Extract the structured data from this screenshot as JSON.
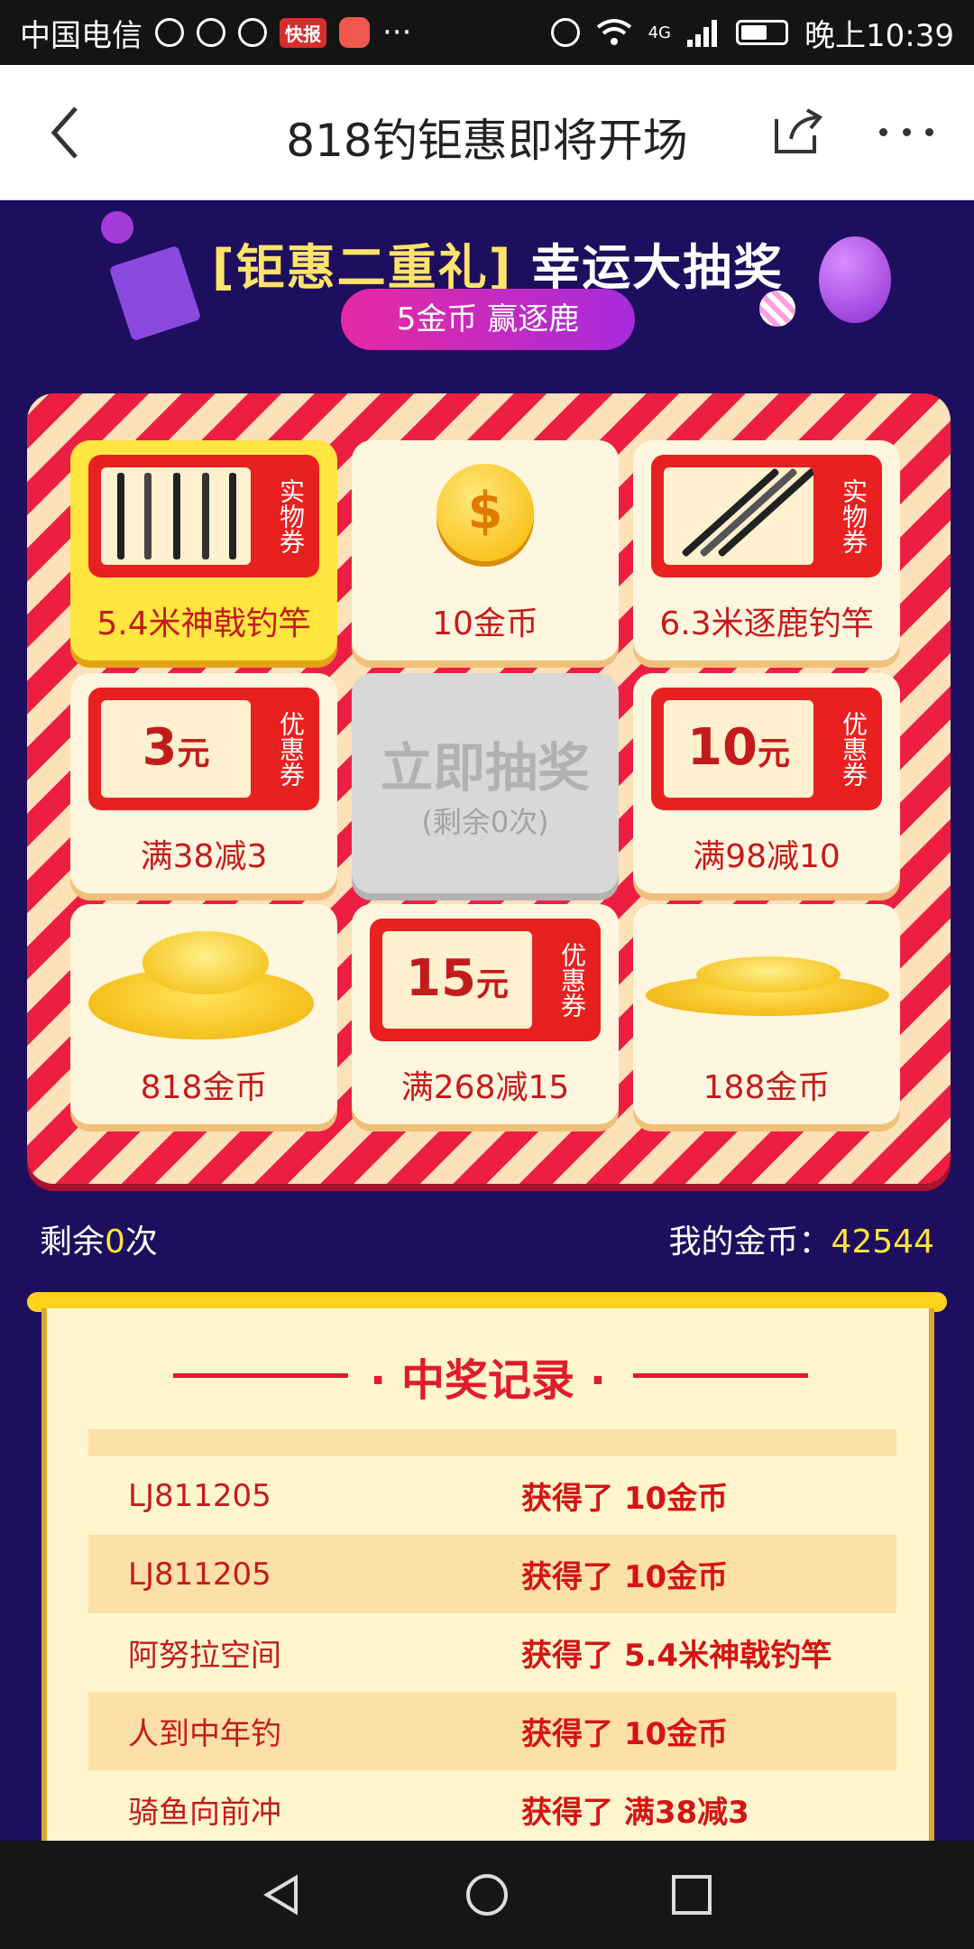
{
  "status_bar": {
    "carrier": "中国电信",
    "badge": "快报",
    "time": "晚上10:39",
    "network": "4G"
  },
  "app_bar": {
    "title": "818钓钜惠即将开场"
  },
  "banner": {
    "headline_bracket": "[钜惠二重礼]",
    "headline_main": "幸运大抽奖",
    "pill": "5金币 赢逐鹿"
  },
  "grid": {
    "prizes": [
      {
        "label": "5.4米神戟钓竿",
        "tag": "实物券"
      },
      {
        "label": "10金币"
      },
      {
        "label": "6.3米逐鹿钓竿",
        "tag": "实物券"
      },
      {
        "label": "满38减3",
        "amount": "3",
        "unit": "元",
        "tag": "优惠券"
      },
      {
        "label": "满98减10",
        "amount": "10",
        "unit": "元",
        "tag": "优惠券"
      },
      {
        "label": "818金币"
      },
      {
        "label": "满268减15",
        "amount": "15",
        "unit": "元",
        "tag": "优惠券"
      },
      {
        "label": "188金币"
      }
    ],
    "center_main": "立即抽奖",
    "center_sub": "(剩余0次)"
  },
  "info": {
    "remain_prefix": "剩余",
    "remain_count": "0",
    "remain_suffix": "次",
    "coins_label": "我的金币：",
    "coins_value": "42544"
  },
  "record": {
    "title": "· 中奖记录 ·",
    "rows": [
      {
        "user": "LJ811205",
        "prize": "获得了 10金币"
      },
      {
        "user": "LJ811205",
        "prize": "获得了 10金币"
      },
      {
        "user": "阿努拉空间",
        "prize": "获得了 5.4米神戟钓竿"
      },
      {
        "user": "人到中年钓",
        "prize": "获得了 10金币"
      },
      {
        "user": "骑鱼向前冲",
        "prize": "获得了 满38减3"
      }
    ]
  },
  "colors": {
    "page_bg": "#1e0f5e",
    "accent_red": "#e8201f",
    "gold": "#ffe43b"
  }
}
